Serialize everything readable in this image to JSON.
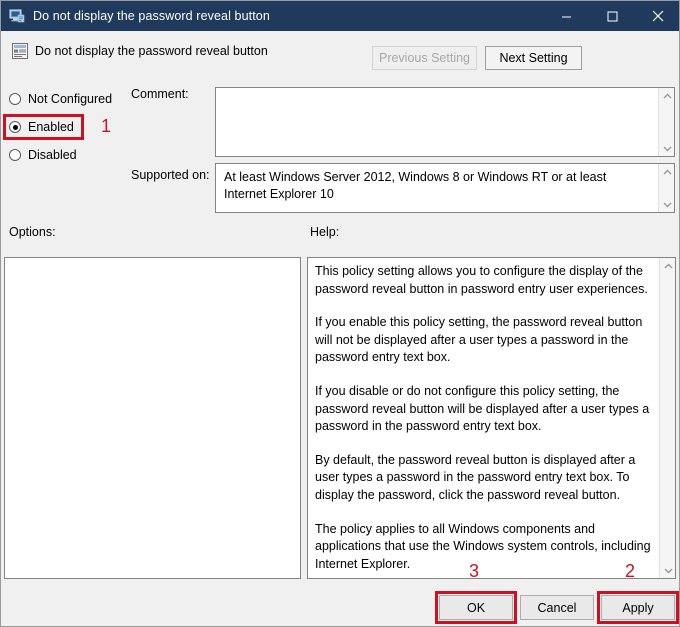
{
  "window": {
    "title": "Do not display the password reveal button",
    "title_icon": "computer-policy-icon",
    "controls": {
      "minimize": "minimize-icon",
      "maximize": "maximize-icon",
      "close": "close-icon"
    }
  },
  "header": {
    "icon": "policy-setting-icon",
    "title": "Do not display the password reveal button",
    "previous_setting_label": "Previous Setting",
    "next_setting_label": "Next Setting",
    "previous_setting_disabled": true
  },
  "state": {
    "options": [
      {
        "label": "Not Configured",
        "selected": false
      },
      {
        "label": "Enabled",
        "selected": true
      },
      {
        "label": "Disabled",
        "selected": false
      }
    ]
  },
  "comment": {
    "label": "Comment:",
    "value": "",
    "scroll_up_icon": "chevron-up-icon",
    "scroll_down_icon": "chevron-down-icon"
  },
  "supported_on": {
    "label": "Supported on:",
    "value": "At least Windows Server 2012, Windows 8 or Windows RT or at least Internet Explorer 10",
    "scroll_up_icon": "chevron-up-icon",
    "scroll_down_icon": "chevron-down-icon"
  },
  "panels": {
    "options_label": "Options:",
    "options_content": "",
    "help_label": "Help:",
    "help_paragraphs": [
      "This policy setting allows you to configure the display of the password reveal button in password entry user experiences.",
      "If you enable this policy setting, the password reveal button will not be displayed after a user types a password in the password entry text box.",
      "If you disable or do not configure this policy setting, the password reveal button will be displayed after a user types a password in the password entry text box.",
      "By default, the password reveal button is displayed after a user types a password in the password entry text box. To display the password, click the password reveal button.",
      "The policy applies to all Windows components and applications that use the Windows system controls, including Internet Explorer."
    ]
  },
  "footer": {
    "ok_label": "OK",
    "cancel_label": "Cancel",
    "apply_label": "Apply"
  },
  "annotations": {
    "step_1": "1",
    "step_2": "2",
    "step_3": "3",
    "color": "#cc1122"
  },
  "colors": {
    "titlebar": "#1f3a5c",
    "body": "#f0f0f0",
    "field": "#ffffff",
    "annotation_red": "#cc1122"
  }
}
